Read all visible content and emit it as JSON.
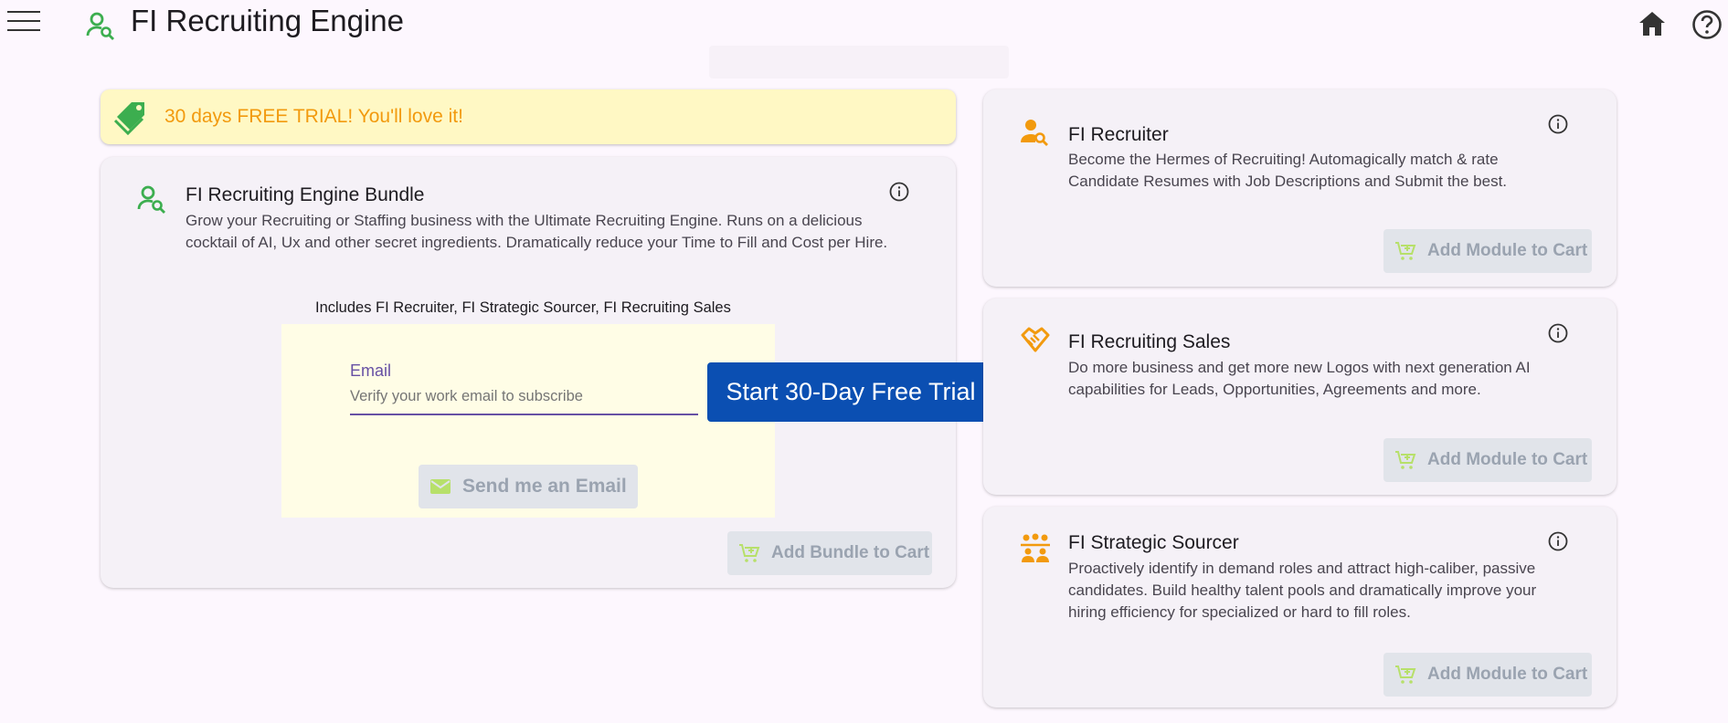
{
  "app": {
    "title": "FI Recruiting Engine"
  },
  "banner": {
    "text": "30 days FREE TRIAL! You'll love it!"
  },
  "bundle": {
    "title": "FI Recruiting Engine Bundle",
    "description": "Grow your Recruiting or Staffing business with the Ultimate Recruiting Engine. Runs on a delicious cocktail of AI, Ux and other secret ingredients. Dramatically reduce your Time to Fill and Cost per Hire.",
    "includes": "Includes FI Recruiter, FI Strategic Sourcer, FI Recruiting Sales",
    "email_label": "Email",
    "email_placeholder": "Verify your work email to subscribe",
    "send_button": "Send me an Email",
    "cart_button": "Add Bundle to Cart"
  },
  "trial_button": "Start 30-Day Free Trial",
  "modules": [
    {
      "title": "FI Recruiter",
      "description": "Become the Hermes of Recruiting! Automagically match & rate Candidate Resumes with Job Descriptions and Submit the best.",
      "cart_button": "Add Module to Cart"
    },
    {
      "title": "FI Recruiting Sales",
      "description": "Do more business and get more new Logos with next generation AI capabilities for Leads, Opportunities, Agreements and more.",
      "cart_button": "Add Module to Cart"
    },
    {
      "title": "FI Strategic Sourcer",
      "description": "Proactively identify  in demand roles and attract high-caliber, passive candidates. Build healthy talent pools and dramatically improve your hiring efficiency for specialized or hard to fill roles.",
      "cart_button": "Add Module to Cart"
    }
  ],
  "colors": {
    "accent_green": "#3cae4f",
    "accent_orange": "#f29a0e",
    "trial_blue": "#0b4fb2",
    "banner_yellow": "#fff8c4"
  },
  "icons": {
    "menu": "hamburger-menu-icon",
    "app": "person-search-icon",
    "home": "home-icon",
    "help": "help-circle-icon",
    "banner": "tag-icon",
    "info": "info-icon",
    "cart": "add-cart-icon",
    "email": "envelope-icon"
  }
}
